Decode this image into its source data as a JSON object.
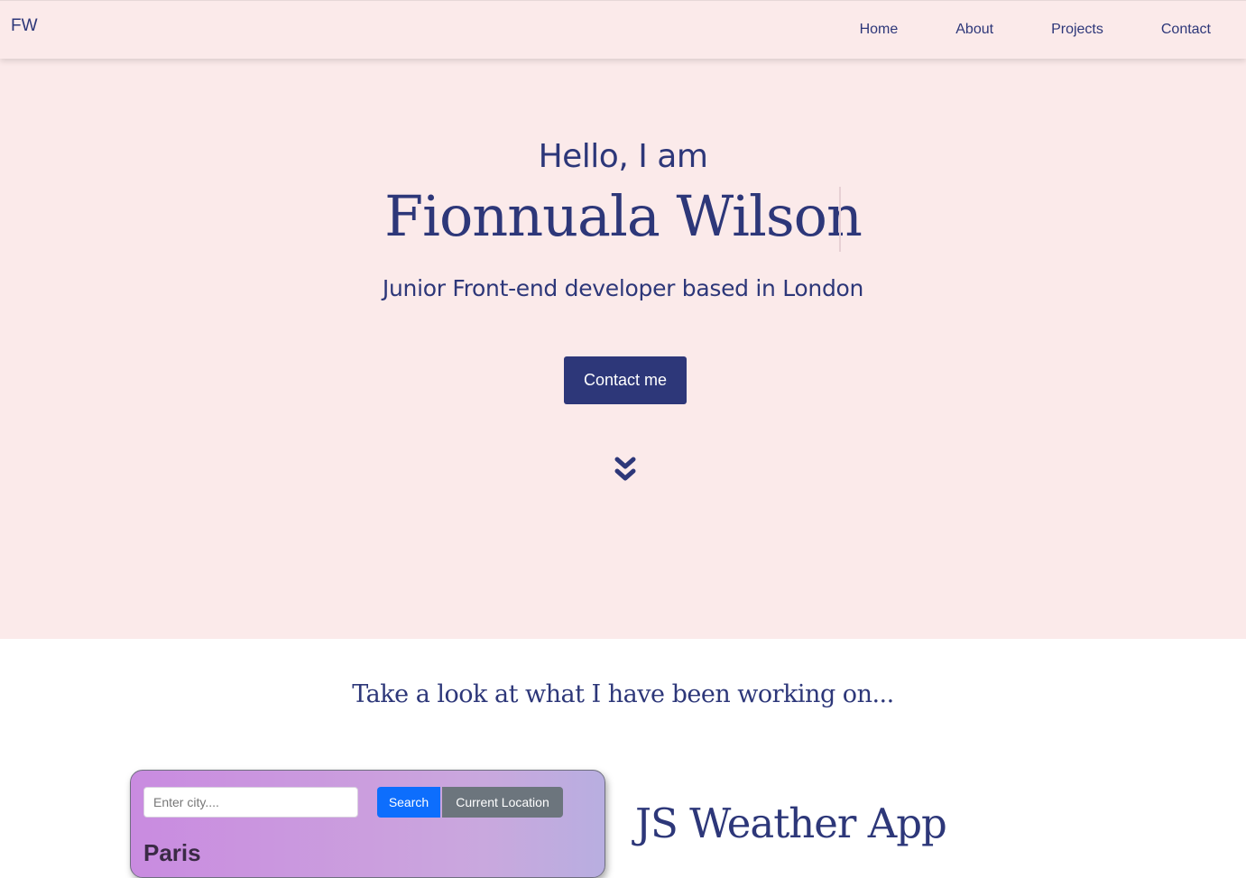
{
  "nav": {
    "brand": "FW",
    "links": [
      "Home",
      "About",
      "Projects",
      "Contact"
    ]
  },
  "hero": {
    "greeting": "Hello, I am",
    "name": "Fionnuala Wilson",
    "tagline": "Junior Front-end developer based in London",
    "cta_label": "Contact me",
    "scroll_icon": "double-chevron-down-icon"
  },
  "projects": {
    "heading": "Take a look at what I have been working on...",
    "items": [
      {
        "title": "JS Weather App",
        "preview": {
          "input_placeholder": "Enter city....",
          "search_label": "Search",
          "location_label": "Current Location",
          "city": "Paris"
        }
      }
    ]
  },
  "colors": {
    "primary": "#2d3779",
    "hero_background": "#fbeaea",
    "section_background": "#ffffff",
    "search_button": "#0d6efd",
    "location_button": "#6c757d"
  }
}
